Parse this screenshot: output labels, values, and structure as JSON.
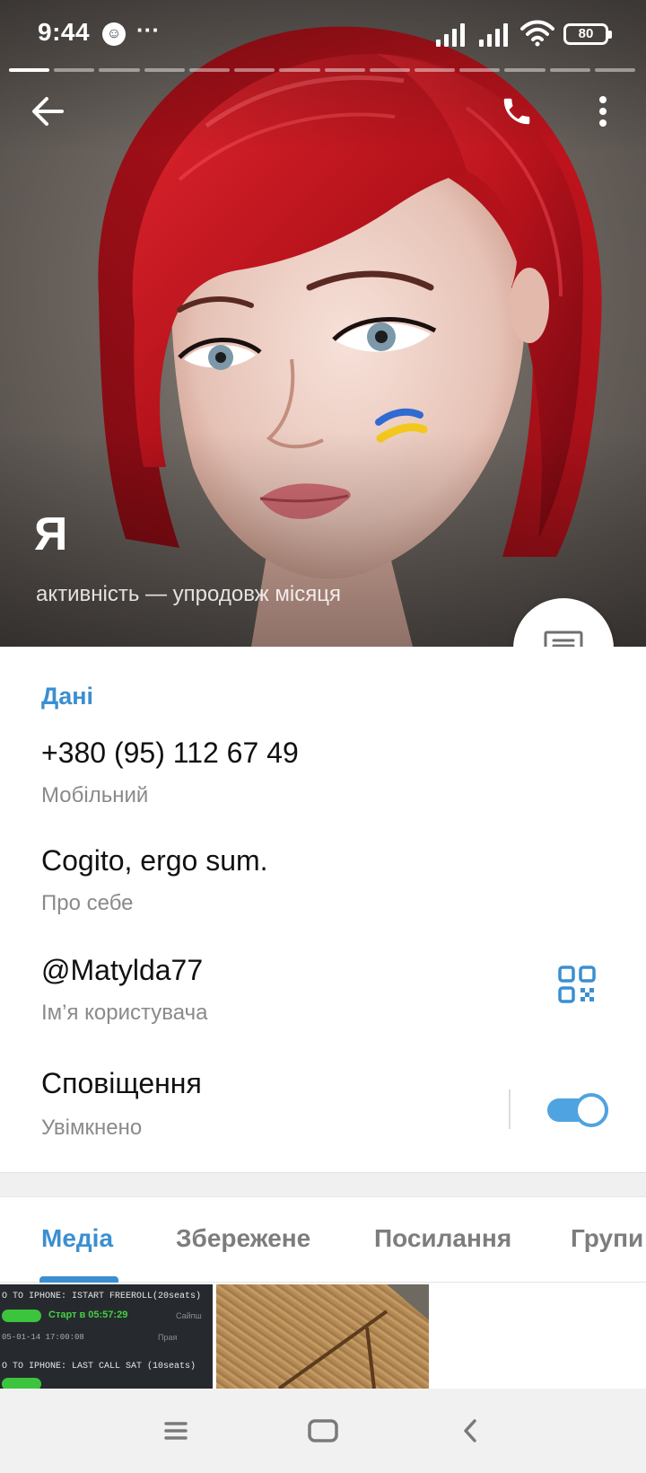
{
  "status_bar": {
    "time": "9:44",
    "emoji_icon": "laughing-face-icon",
    "overflow_dots": "···",
    "battery": "80"
  },
  "story_segments": {
    "active_index": 0,
    "count": 14
  },
  "header": {
    "back_icon": "arrow-left-icon",
    "call_icon": "phone-icon",
    "more_icon": "vertical-dots-icon"
  },
  "profile": {
    "name": "Я",
    "status": "активність — упродовж місяця",
    "message_icon": "message-bubble-icon"
  },
  "info": {
    "section_title": "Дані",
    "phone": {
      "value": "+380 (95) 112 67 49",
      "label": "Мобільний"
    },
    "bio": {
      "value": "Cogito, ergo sum.",
      "label": "Про себе"
    },
    "username": {
      "value": "@Matylda77",
      "label": "Ім’я користувача",
      "qr_icon": "qr-code-icon"
    },
    "notifications": {
      "value": "Сповіщення",
      "label": "Увімкнено",
      "toggle_on": true
    }
  },
  "tabs": {
    "items": [
      "Медіа",
      "Збережене",
      "Посилання",
      "Групи"
    ],
    "active_index": 0
  },
  "media": {
    "thumb1": {
      "line1": "O TO IPHONE: ISTART FREEROLL(20seats)",
      "green1": "Старт в 05:57:29",
      "dim1": "Сайпш",
      "line2": "05-01-14 17:00:08",
      "dim2": "Прaя",
      "line3": "O TO IPHONE: LAST CALL SAT (10seats)"
    },
    "thumb2": "photo"
  },
  "nav": {
    "menu_icon": "menu-lines-icon",
    "home_icon": "home-square-icon",
    "back_icon": "chevron-left-icon"
  },
  "colors": {
    "accent": "#3b8fd0",
    "toggle": "#4fa3e0",
    "hair": "#b5121b"
  }
}
